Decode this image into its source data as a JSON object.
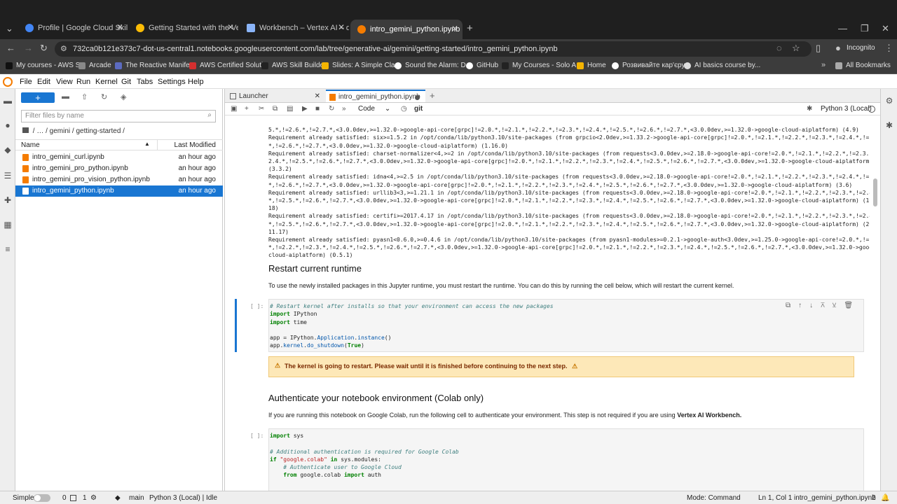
{
  "browser": {
    "tabs": [
      {
        "label": "Profile | Google Cloud Skills Boost",
        "color": "#4285f4"
      },
      {
        "label": "Getting Started with the Vertex AI",
        "color": "#fbbc05"
      },
      {
        "label": "Workbench – Vertex AI – qwiklabs",
        "color": "#8ab4f8"
      },
      {
        "label": "intro_gemini_python.ipynb",
        "color": "#f57c00"
      }
    ],
    "url": "732ca0b121e373c7-dot-us-central1.notebooks.googleusercontent.com/lab/tree/generative-ai/gemini/getting-started/intro_gemini_python.ipynb",
    "profile": "Incognito",
    "bookmarks": [
      "My courses - AWS S...",
      "Arcade",
      "The Reactive Manife...",
      "AWS Certified Soluti...",
      "AWS Skill Builder",
      "Slides: A Simple Cla...",
      "Sound the Alarm: D...",
      "GitHub",
      "My Courses - Solo A...",
      "Home",
      "Розвивайте кар'єру...",
      "AI basics course by..."
    ],
    "all_bookmarks": "All Bookmarks"
  },
  "menus": [
    "File",
    "Edit",
    "View",
    "Run",
    "Kernel",
    "Git",
    "Tabs",
    "Settings",
    "Help"
  ],
  "filebrowser": {
    "new_label": "+",
    "search_placeholder": "Filter files by name",
    "breadcrumb": "/ … / gemini / getting-started /",
    "col_name": "Name",
    "col_modified": "Last Modified",
    "files": [
      {
        "name": "intro_gemini_curl.ipynb",
        "modified": "an hour ago"
      },
      {
        "name": "intro_gemini_pro_python.ipynb",
        "modified": "an hour ago"
      },
      {
        "name": "intro_gemini_pro_vision_python.ipynb",
        "modified": "an hour ago"
      },
      {
        "name": "intro_gemini_python.ipynb",
        "modified": "an hour ago"
      }
    ]
  },
  "doctabs": {
    "launcher": "Launcher",
    "notebook": "intro_gemini_python.ipynb"
  },
  "toolbar": {
    "cell_type": "Code",
    "git": "git",
    "kernel": "Python 3 (Local)"
  },
  "output_lines": [
    "5.*,!=2.6.*,!=2.7.*,<3.0.0dev,>=1.32.0->google-api-core[grpc]!=2.0.*,!=2.1.*,!=2.2.*,!=2.3.*,!=2.4.*,!=2.5.*,!=2.6.*,!=2.7.*,<3.0.0dev,>=1.32.0->google-cloud-aiplatform) (4.9)",
    "Requirement already satisfied: six>=1.5.2 in /opt/conda/lib/python3.10/site-packages (from grpcio<2.0dev,>=1.33.2->google-api-core[grpc]!=2.0.*,!=2.1.*,!=2.2.*,!=2.3.*,!=2.4.*,!=2.5.",
    "*,!=2.6.*,!=2.7.*,<3.0.0dev,>=1.32.0->google-cloud-aiplatform) (1.16.0)",
    "Requirement already satisfied: charset-normalizer<4,>=2 in /opt/conda/lib/python3.10/site-packages (from requests<3.0.0dev,>=2.18.0->google-api-core!=2.0.*,!=2.1.*,!=2.2.*,!=2.3.*,!=",
    "2.4.*,!=2.5.*,!=2.6.*,!=2.7.*,<3.0.0dev,>=1.32.0->google-api-core[grpc]!=2.0.*,!=2.1.*,!=2.2.*,!=2.3.*,!=2.4.*,!=2.5.*,!=2.6.*,!=2.7.*,<3.0.0dev,>=1.32.0->google-cloud-aiplatform)",
    "(3.3.2)",
    "Requirement already satisfied: idna<4,>=2.5 in /opt/conda/lib/python3.10/site-packages (from requests<3.0.0dev,>=2.18.0->google-api-core!=2.0.*,!=2.1.*,!=2.2.*,!=2.3.*,!=2.4.*,!=2.5.",
    "*,!=2.6.*,!=2.7.*,<3.0.0dev,>=1.32.0->google-api-core[grpc]!=2.0.*,!=2.1.*,!=2.2.*,!=2.3.*,!=2.4.*,!=2.5.*,!=2.6.*,!=2.7.*,<3.0.0dev,>=1.32.0->google-cloud-aiplatform) (3.6)",
    "Requirement already satisfied: urllib3<3,>=1.21.1 in /opt/conda/lib/python3.10/site-packages (from requests<3.0.0dev,>=2.18.0->google-api-core!=2.0.*,!=2.1.*,!=2.2.*,!=2.3.*,!=2.4.",
    "*,!=2.5.*,!=2.6.*,!=2.7.*,<3.0.0dev,>=1.32.0->google-api-core[grpc]!=2.0.*,!=2.1.*,!=2.2.*,!=2.3.*,!=2.4.*,!=2.5.*,!=2.6.*,!=2.7.*,<3.0.0dev,>=1.32.0->google-cloud-aiplatform) (1.26.",
    "18)",
    "Requirement already satisfied: certifi>=2017.4.17 in /opt/conda/lib/python3.10/site-packages (from requests<3.0.0dev,>=2.18.0->google-api-core!=2.0.*,!=2.1.*,!=2.2.*,!=2.3.*,!=2.4.",
    "*,!=2.5.*,!=2.6.*,!=2.7.*,<3.0.0dev,>=1.32.0->google-api-core[grpc]!=2.0.*,!=2.1.*,!=2.2.*,!=2.3.*,!=2.4.*,!=2.5.*,!=2.6.*,!=2.7.*,<3.0.0dev,>=1.32.0->google-cloud-aiplatform) (2023.",
    "11.17)",
    "Requirement already satisfied: pyasn1<0.6.0,>=0.4.6 in /opt/conda/lib/python3.10/site-packages (from pyasn1-modules>=0.2.1->google-auth<3.0dev,>=1.25.0->google-api-core!=2.0.*,!=2.1.",
    "*,!=2.2.*,!=2.3.*,!=2.4.*,!=2.5.*,!=2.6.*,!=2.7.*,<3.0.0dev,>=1.32.0->google-api-core[grpc]!=2.0.*,!=2.1.*,!=2.2.*,!=2.3.*,!=2.4.*,!=2.5.*,!=2.6.*,!=2.7.*,<3.0.0dev,>=1.32.0->google-",
    "cloud-aiplatform) (0.5.1)"
  ],
  "section1": {
    "heading": "Restart current runtime",
    "text": "To use the newly installed packages in this Jupyter runtime, you must restart the runtime. You can do this by running the cell below, which will restart the current kernel."
  },
  "cell1": {
    "prompt": "[ ]:",
    "comment": "# Restart kernel after installs so that your environment can access the new packages",
    "kw_import": "import",
    "mod_ipython": "IPython",
    "mod_time": "time",
    "assign": "app = IPython.",
    "app_cls": "Application",
    "dot": ".",
    "instance": "instance",
    "paren": "()",
    "shutdown_pre": "app.",
    "kernel": "kernel",
    "do_shutdown": "do_shutdown",
    "open": "(",
    "true": "True",
    "close": ")"
  },
  "warning": "The kernel is going to restart. Please wait until it is finished before continuing to the next step.",
  "section2": {
    "heading": "Authenticate your notebook environment (Colab only)",
    "text": "If you are running this notebook on Google Colab, run the following cell to authenticate your environment. This step is not required if you are using",
    "text_bold": "Vertex AI Workbench."
  },
  "cell2": {
    "prompt": "[ ]:",
    "import_sys_kw": "import",
    "import_sys": "sys",
    "comment1": "# Additional authentication is required for Google Colab",
    "if_kw": "if",
    "colab_str": "\"google.colab\"",
    "in_kw": "in",
    "sys_modules": "sys.modules:",
    "comment2": "# Authenticate user to Google Cloud",
    "from_kw": "from",
    "from_mod": "google.colab",
    "import_kw": "import",
    "auth": "auth"
  },
  "status": {
    "mode": "Simple",
    "zero": "0",
    "one": "1",
    "branch": "main",
    "kernel": "Python 3 (Local) | Idle",
    "cmd_mode": "Mode: Command",
    "position": "Ln 1, Col 1",
    "filename": "intro_gemini_python.ipynb",
    "count": "2"
  }
}
